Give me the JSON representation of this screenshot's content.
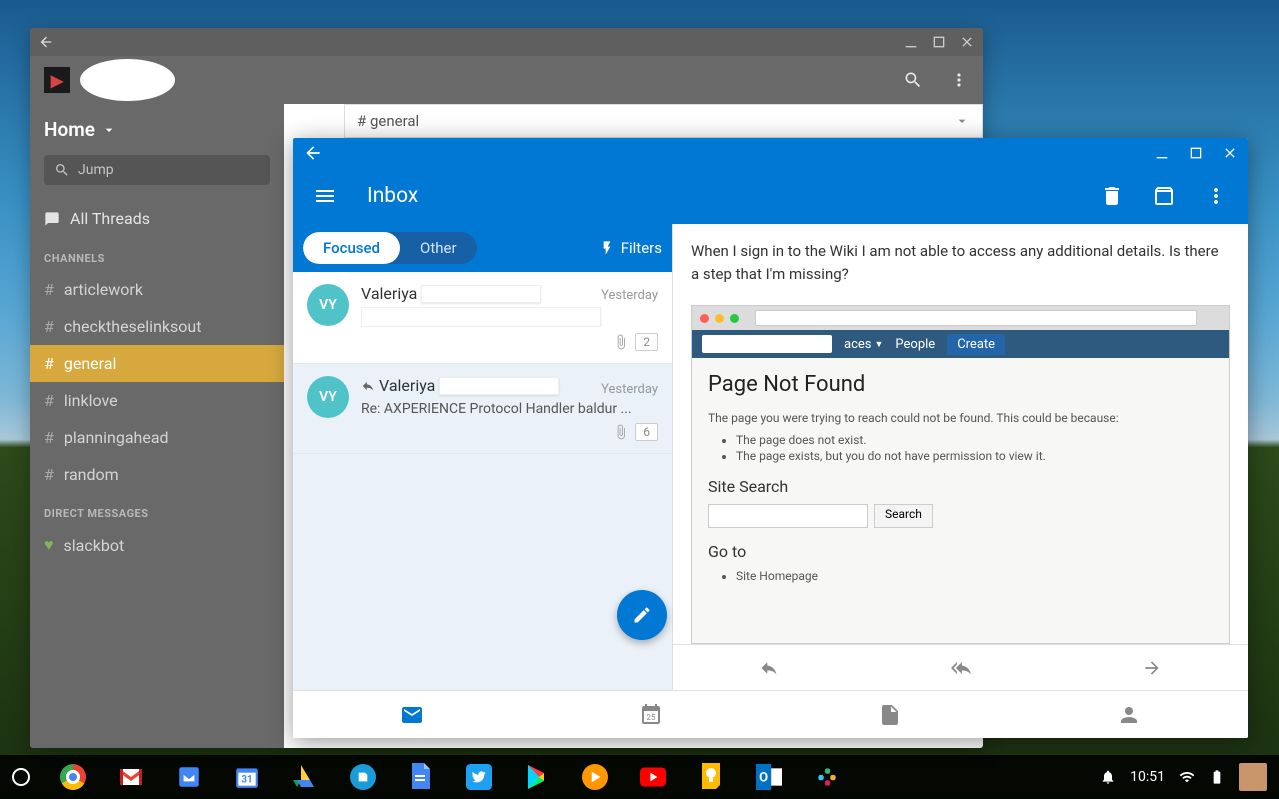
{
  "slack": {
    "home_label": "Home",
    "jump_placeholder": "Jump",
    "all_threads": "All Threads",
    "channels_header": "CHANNELS",
    "channels": [
      "articlework",
      "checktheselinksout",
      "general",
      "linklove",
      "planningahead",
      "random"
    ],
    "active_channel_index": 2,
    "dm_header": "DIRECT MESSAGES",
    "dms": [
      "slackbot"
    ],
    "channel_header": "#  general"
  },
  "outlook": {
    "title": "Inbox",
    "tabs": {
      "focused": "Focused",
      "other": "Other"
    },
    "filters_label": "Filters",
    "emails": [
      {
        "avatar": "VY",
        "sender": "Valeriya",
        "date": "Yesterday",
        "subject": "",
        "attachment": true,
        "badge": "2"
      },
      {
        "avatar": "VY",
        "sender": "Valeriya",
        "date": "Yesterday",
        "subject": "Re: AXPERIENCE Protocol Handler baldur ...",
        "attachment": true,
        "badge": "6",
        "reply": true
      }
    ],
    "preview": {
      "body": "When I sign in to the Wiki I am not able to access any additional details. Is there a step that I'm missing?",
      "embedded": {
        "nav_spaces": "aces",
        "nav_people": "People",
        "nav_create": "Create",
        "h1": "Page Not Found",
        "p1": "The page you were trying to reach could not be found. This could be because:",
        "li1": "The page does not exist.",
        "li2": "The page exists, but you do not have permission to view it.",
        "h2_search": "Site Search",
        "search_btn": "Search",
        "h2_goto": "Go to",
        "li_goto": "Site Homepage"
      }
    }
  },
  "taskbar": {
    "time": "10:51"
  }
}
